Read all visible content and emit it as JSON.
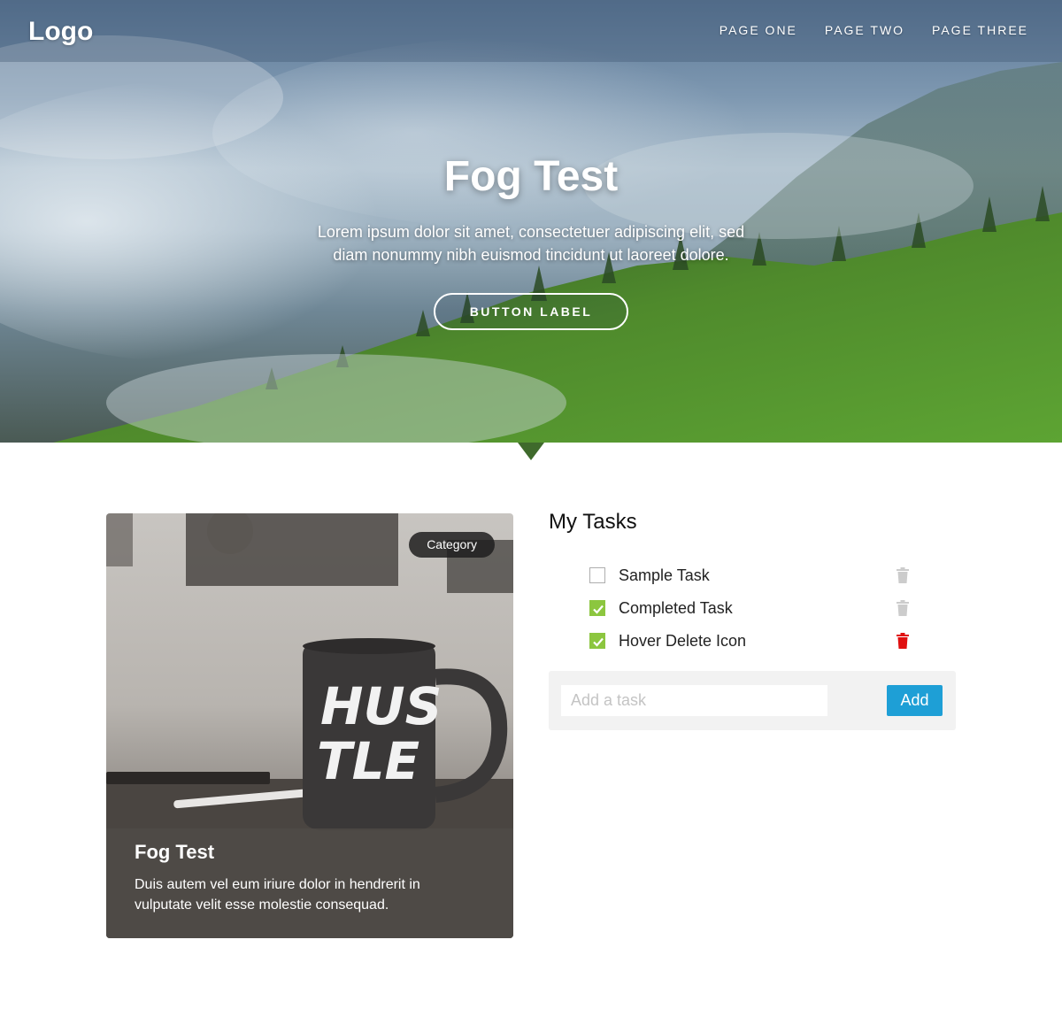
{
  "header": {
    "logo": "Logo",
    "nav": [
      "PAGE ONE",
      "PAGE TWO",
      "PAGE THREE"
    ]
  },
  "hero": {
    "title": "Fog Test",
    "subtitle": "Lorem ipsum dolor sit amet, consectetuer adipiscing elit, sed diam nonummy nibh euismod tincidunt ut laoreet dolore.",
    "button_label": "BUTTON LABEL"
  },
  "card": {
    "badge": "Category",
    "title": "Fog Test",
    "text": "Duis autem vel eum iriure dolor in hendrerit in vulputate velit esse molestie consequad.",
    "mug_text": "HUSTLE"
  },
  "tasks": {
    "title": "My Tasks",
    "items": [
      {
        "label": "Sample Task",
        "checked": false,
        "delete_icon_color": "#cccccc"
      },
      {
        "label": "Completed Task",
        "checked": true,
        "delete_icon_color": "#cccccc"
      },
      {
        "label": "Hover Delete Icon",
        "checked": true,
        "delete_icon_color": "#e01010"
      }
    ],
    "input_placeholder": "Add a task",
    "add_label": "Add"
  },
  "colors": {
    "accent_blue": "#1e9fd6",
    "check_green": "#8cc63f",
    "delete_red": "#e01010"
  }
}
